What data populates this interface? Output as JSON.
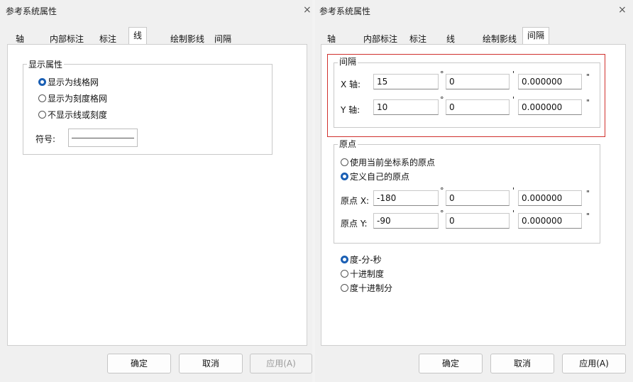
{
  "left": {
    "title": "参考系统属性",
    "tabs": [
      "轴",
      "内部标注",
      "标注",
      "线",
      "绘制影线",
      "间隔"
    ],
    "display_group": {
      "label": "显示属性",
      "options": [
        "显示为线格网",
        "显示为刻度格网",
        "不显示线或刻度"
      ],
      "selected": 0
    },
    "symbol_label": "符号:",
    "buttons": {
      "ok": "确定",
      "cancel": "取消",
      "apply": "应用(A)"
    }
  },
  "right": {
    "title": "参考系统属性",
    "tabs": [
      "轴",
      "内部标注",
      "标注",
      "线",
      "绘制影线",
      "间隔"
    ],
    "interval_group": {
      "label": "间隔",
      "rows": [
        {
          "label": "X 轴:",
          "deg": "15",
          "min": "0",
          "sec": "0.000000"
        },
        {
          "label": "Y 轴:",
          "deg": "10",
          "min": "0",
          "sec": "0.000000"
        }
      ]
    },
    "origin_group": {
      "label": "原点",
      "options": [
        "使用当前坐标系的原点",
        "定义自己的原点"
      ],
      "selected": 1,
      "rows": [
        {
          "label": "原点 X:",
          "deg": "-180",
          "min": "0",
          "sec": "0.000000"
        },
        {
          "label": "原点 Y:",
          "deg": "-90",
          "min": "0",
          "sec": "0.000000"
        }
      ]
    },
    "format_options": [
      "度-分-秒",
      "十进制度",
      "度十进制分"
    ],
    "format_selected": 0,
    "units": {
      "deg": "°",
      "min": "'",
      "sec": "\""
    },
    "buttons": {
      "ok": "确定",
      "cancel": "取消",
      "apply": "应用(A)"
    }
  },
  "close_glyph": "×",
  "colors": {
    "accent": "#1a5fb4",
    "highlight_box": "#d0312d"
  }
}
